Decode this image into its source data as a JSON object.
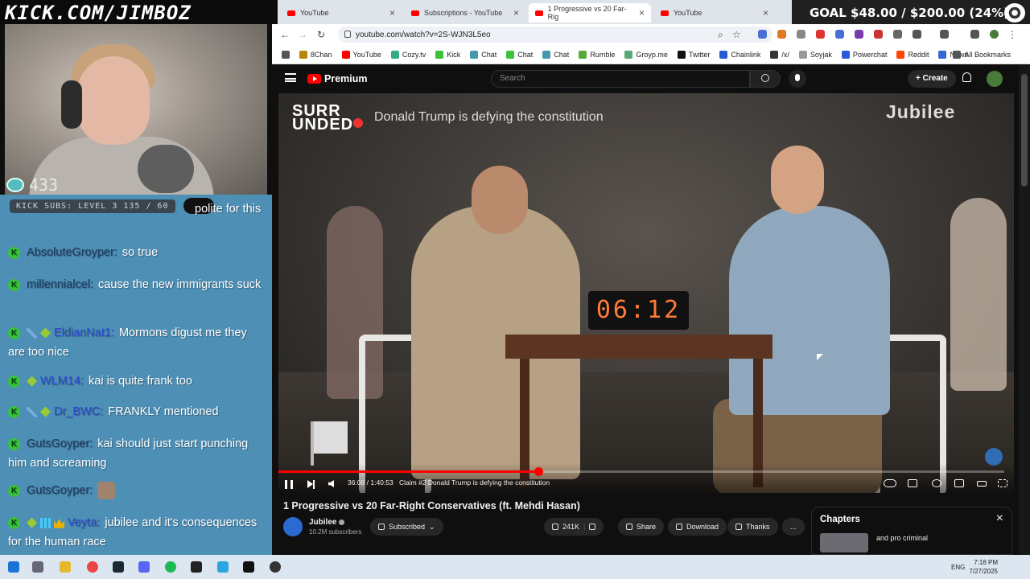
{
  "stream": {
    "brand": "KICK.COM/JIMBOZ",
    "viewer_count": "433",
    "subs_label": "KICK SUBS: LEVEL 3 135 / 60",
    "goal": "GOAL $48.00 / $200.00 (24%)"
  },
  "chat": [
    {
      "user": "",
      "text": "polite for this",
      "badges": []
    },
    {
      "user": "AbsoluteGroyper:",
      "text": "so true",
      "badges": [
        "k"
      ]
    },
    {
      "user": "millennialcel:",
      "text": "cause the new immigrants suck",
      "badges": [
        "k"
      ]
    },
    {
      "user": "EldianNat1:",
      "text": "Mormons digust me they are too nice",
      "badges": [
        "k",
        "sword",
        "diamond"
      ]
    },
    {
      "user": "WLM14:",
      "text": "kai is quite frank too",
      "badges": [
        "k",
        "diamond"
      ]
    },
    {
      "user": "Dr_BWC:",
      "text": "FRANKLY mentioned",
      "badges": [
        "k",
        "sword",
        "diamond"
      ]
    },
    {
      "user": "GutsGoyper:",
      "text": "kai should just start punching him and screaming",
      "badges": [
        "k"
      ]
    },
    {
      "user": "GutsGoyper:",
      "text": "",
      "badges": [
        "k"
      ]
    },
    {
      "user": "Veyta:",
      "text": "jubilee and it's consequences for the human race",
      "badges": [
        "k",
        "diamond",
        "grid",
        "crown"
      ]
    }
  ],
  "browser": {
    "tabs": [
      {
        "label": "YouTube",
        "active": false
      },
      {
        "label": "Subscriptions - YouTube",
        "active": false
      },
      {
        "label": "1 Progressive vs 20 Far-Rig",
        "active": true
      },
      {
        "label": "YouTube",
        "active": false
      }
    ],
    "url": "youtube.com/watch?v=2S-WJN3L5eo",
    "bookmarks": [
      "8Chan",
      "YouTube",
      "Cozy.tv",
      "Kick",
      "Chat",
      "Chat",
      "Chat",
      "Rumble",
      "Groyp.me",
      "Twitter",
      "Chainlink",
      "/x/",
      "Soyjak",
      "Powerchat",
      "Reddit",
      "News"
    ],
    "all_bookmarks": "All Bookmarks"
  },
  "youtube": {
    "logo": "Premium",
    "search_placeholder": "Search",
    "create": "+ Create",
    "overlay_logo": "SURR UNDED",
    "overlay_title": "Donald Trump is defying the constitution",
    "watermark": "Jubilee",
    "timer": "06:12",
    "time": "36:08 / 1:40:53",
    "chapter": "Claim #2 Donald Trump is defying the constitution",
    "progress": 0.358,
    "title": "1 Progressive vs 20 Far-Right Conservatives (ft. Mehdi Hasan)",
    "channel": "Jubilee",
    "subscribers": "10.2M subscribers",
    "subscribed": "Subscribed",
    "likes": "241K",
    "share": "Share",
    "download": "Download",
    "thanks": "Thanks",
    "more": "...",
    "chapters_title": "Chapters",
    "chapter_item": "and pro criminal"
  },
  "taskbar": {
    "lang": "ENG",
    "time": "7:18 PM",
    "date": "7/27/2025"
  }
}
